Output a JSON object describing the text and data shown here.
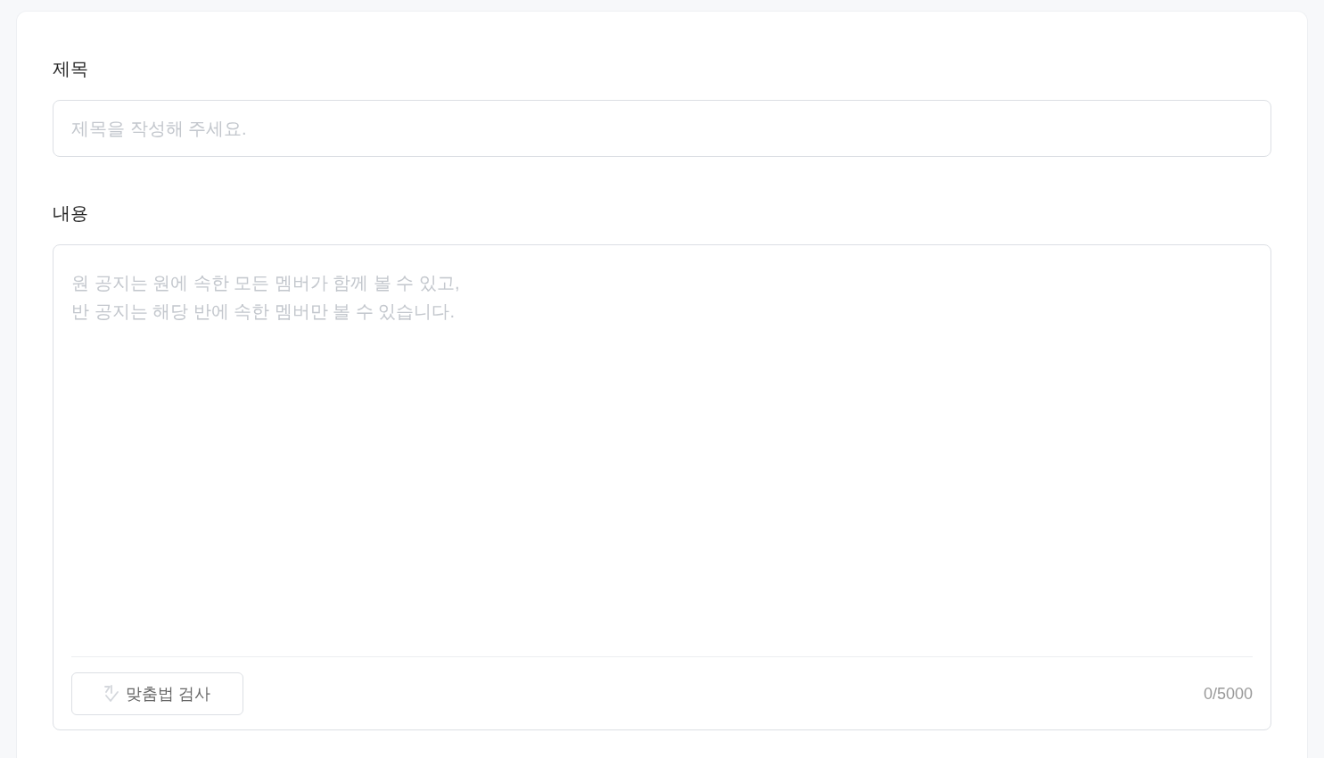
{
  "title_field": {
    "label": "제목",
    "placeholder": "제목을 작성해 주세요."
  },
  "content_field": {
    "label": "내용",
    "placeholder": "원 공지는 원에 속한 모든 멤버가 함께 볼 수 있고,\n반 공지는 해당 반에 속한 멤버만 볼 수 있습니다.",
    "spellcheck_button": "맞춤법 검사",
    "counter": "0/5000"
  }
}
